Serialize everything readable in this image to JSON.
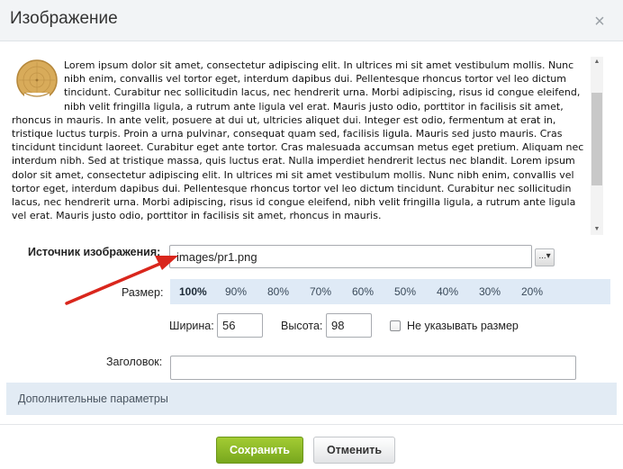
{
  "dialog": {
    "title": "Изображение",
    "close_symbol": "×"
  },
  "preview": {
    "text": "Lorem ipsum dolor sit amet, consectetur adipiscing elit. In ultrices mi sit amet vestibulum mollis. Nunc nibh enim, convallis vel tortor eget, interdum dapibus dui. Pellentesque rhoncus tortor vel leo dictum tincidunt. Curabitur nec sollicitudin lacus, nec hendrerit urna. Morbi adipiscing, risus id congue eleifend, nibh velit fringilla ligula, a rutrum ante ligula vel erat. Mauris justo odio, porttitor in facilisis sit amet, rhoncus in mauris. In ante velit, posuere at dui ut, ultricies aliquet dui. Integer est odio, fermentum at erat in, tristique luctus turpis. Proin a urna pulvinar, consequat quam sed, facilisis ligula. Mauris sed justo mauris. Cras tincidunt tincidunt laoreet. Curabitur eget ante tortor. Cras malesuada accumsan metus eget pretium. Aliquam nec interdum nibh. Sed at tristique massa, quis luctus erat. Nulla imperdiet hendrerit lectus nec blandit. Lorem ipsum dolor sit amet, consectetur adipiscing elit. In ultrices mi sit amet vestibulum mollis. Nunc nibh enim, convallis vel tortor eget, interdum dapibus dui. Pellentesque rhoncus tortor vel leo dictum tincidunt. Curabitur nec sollicitudin lacus, nec hendrerit urna. Morbi adipiscing, risus id congue eleifend, nibh velit fringilla ligula, a rutrum ante ligula vel erat. Mauris justo odio, porttitor in facilisis sit amet, rhoncus in mauris."
  },
  "source": {
    "label": "Источник изображения:",
    "value": "images/pr1.png",
    "browse_label": "...▾"
  },
  "size": {
    "label": "Размер:",
    "options": [
      "100%",
      "90%",
      "80%",
      "70%",
      "60%",
      "50%",
      "40%",
      "30%",
      "20%"
    ],
    "selected": "100%"
  },
  "dimensions": {
    "width_label": "Ширина:",
    "width_value": "56",
    "height_label": "Высота:",
    "height_value": "98",
    "no_size_label": "Не указывать размер"
  },
  "caption": {
    "label": "Заголовок:",
    "value": ""
  },
  "extra": {
    "label": "Дополнительные параметры"
  },
  "footer": {
    "save_label": "Сохранить",
    "cancel_label": "Отменить"
  },
  "colors": {
    "save_button": "#8cbb27",
    "size_bar": "#dfeaf6",
    "annotation_arrow": "#d9261c"
  }
}
